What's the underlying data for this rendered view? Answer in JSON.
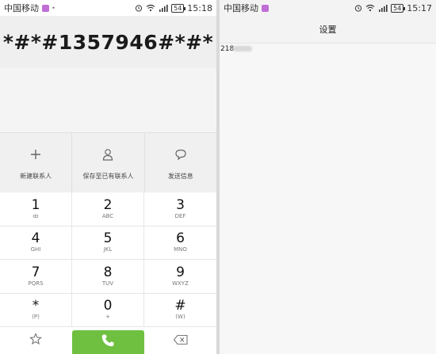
{
  "left_screen": {
    "status_bar": {
      "carrier": "中国移动",
      "battery": "54",
      "time": "15:18",
      "network": "4G"
    },
    "dialed_number": "*#*#1357946#*#*",
    "actions": [
      {
        "label": "新建联系人",
        "icon": "plus-icon"
      },
      {
        "label": "保存至已有联系人",
        "icon": "person-icon"
      },
      {
        "label": "发送信息",
        "icon": "message-bubble-icon"
      }
    ],
    "keypad": [
      {
        "digit": "1",
        "letters": "ꝏ"
      },
      {
        "digit": "2",
        "letters": "ABC"
      },
      {
        "digit": "3",
        "letters": "DEF"
      },
      {
        "digit": "4",
        "letters": "GHI"
      },
      {
        "digit": "5",
        "letters": "JKL"
      },
      {
        "digit": "6",
        "letters": "MNO"
      },
      {
        "digit": "7",
        "letters": "PQRS"
      },
      {
        "digit": "8",
        "letters": "TUV"
      },
      {
        "digit": "9",
        "letters": "WXYZ"
      },
      {
        "digit": "*",
        "letters": "(P)"
      },
      {
        "digit": "0",
        "letters": "+"
      },
      {
        "digit": "#",
        "letters": "(W)"
      }
    ],
    "bottom_bar": {
      "left_icon": "star-icon",
      "center_icon": "phone-icon",
      "right_icon": "backspace-icon"
    },
    "colors": {
      "call_button": "#6fc041"
    }
  },
  "right_screen": {
    "status_bar": {
      "carrier": "中国移动",
      "battery": "54",
      "time": "15:17",
      "network": "4G"
    },
    "title": "设置",
    "code_visible": "218"
  }
}
